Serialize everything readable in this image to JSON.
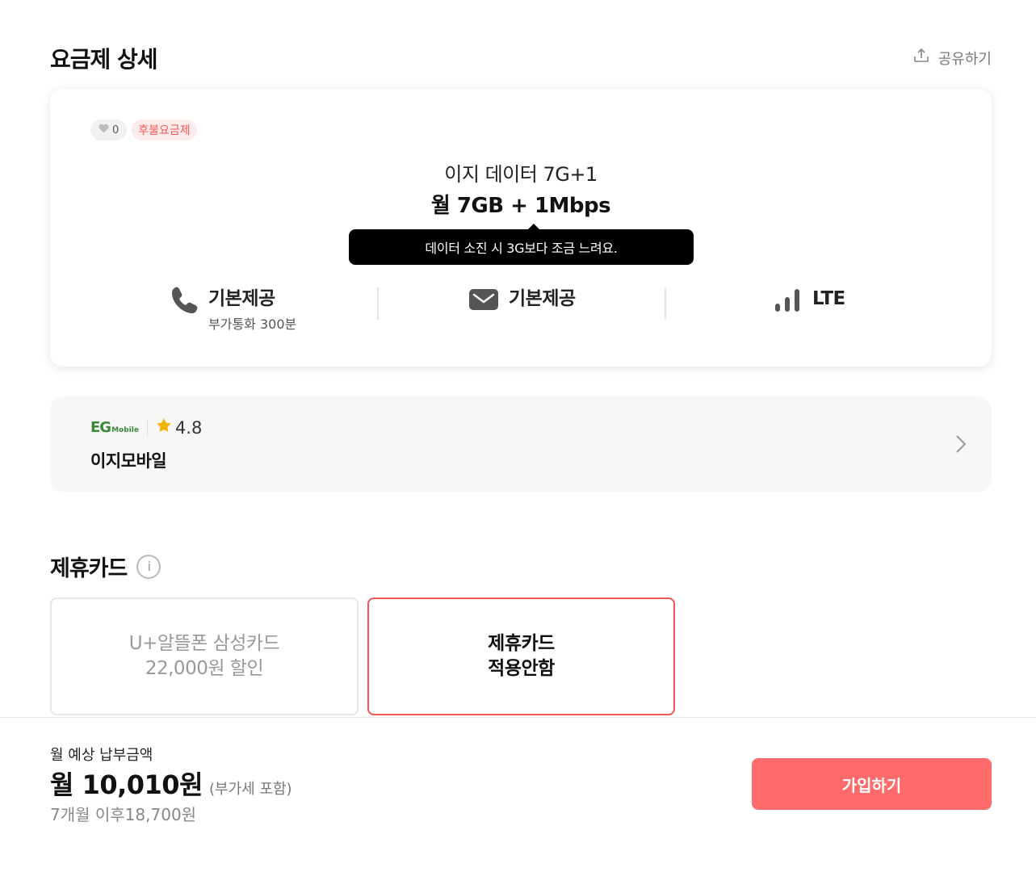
{
  "header": {
    "title": "요금제 상세",
    "share_label": "공유하기"
  },
  "plan": {
    "like_count": "0",
    "type_badge": "후불요금제",
    "name": "이지 데이터 7G+1",
    "data": "월 7GB + 1Mbps",
    "tooltip": "데이터 소진 시 3G보다 조금 느려요.",
    "features": [
      {
        "icon": "phone-icon",
        "title": "기본제공",
        "sub": "부가통화 300분"
      },
      {
        "icon": "mail-icon",
        "title": "기본제공"
      },
      {
        "icon": "signal-icon",
        "title": "LTE"
      }
    ]
  },
  "carrier": {
    "logo_text": "EG",
    "logo_sub": "Mobile",
    "rating": "4.8",
    "name": "이지모바일",
    "star_color": "#f5b301"
  },
  "affiliate": {
    "title": "제휴카드",
    "cards": [
      {
        "line1": "U+알뜰폰 삼성카드",
        "line2": "22,000원 할인",
        "selected": false
      },
      {
        "line1": "제휴카드",
        "line2": "적용안함",
        "selected": true
      }
    ]
  },
  "bottom": {
    "price_label": "월 예상 납부금액",
    "price": "월 10,010원",
    "vat_note": "(부가세 포함)",
    "after_price": "7개월 이후18,700원",
    "join_button": "가입하기",
    "accent": "#ff6b6b"
  }
}
